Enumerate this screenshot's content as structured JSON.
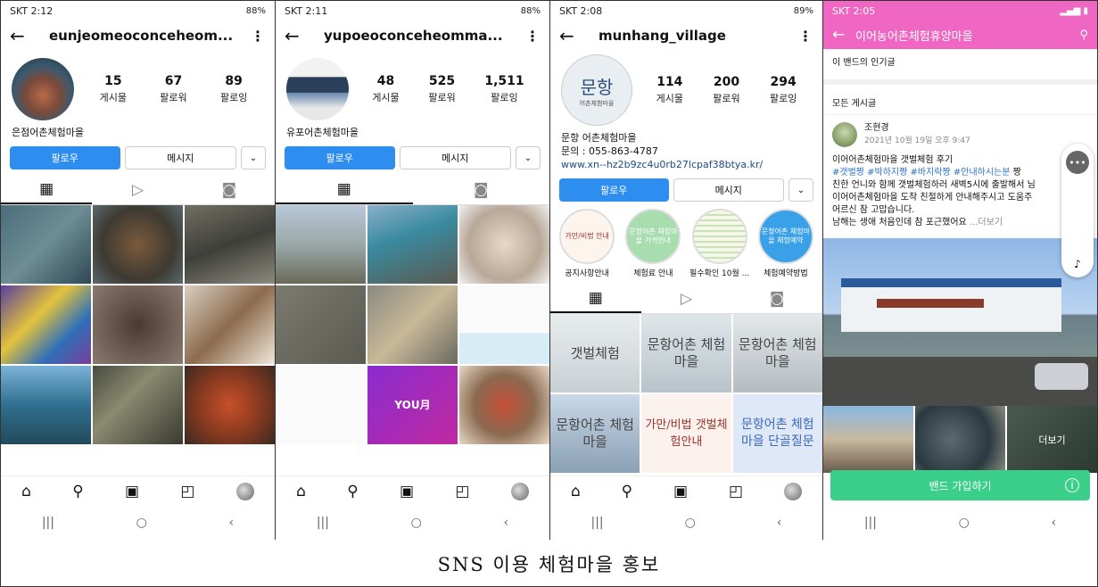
{
  "caption": "SNS 이용 체험마을 홍보",
  "phone1": {
    "status_time": "SKT 2:12",
    "status_right": "88%",
    "username": "eunjeomeoconceheom...",
    "stats": [
      {
        "value": "15",
        "label": "게시물"
      },
      {
        "value": "67",
        "label": "팔로워"
      },
      {
        "value": "89",
        "label": "팔로잉"
      }
    ],
    "name": "은점어촌체험마을",
    "follow_label": "팔로우",
    "message_label": "메시지"
  },
  "phone2": {
    "status_time": "SKT 2:11",
    "status_right": "88%",
    "username": "yupoeoconceheomma...",
    "stats": [
      {
        "value": "48",
        "label": "게시물"
      },
      {
        "value": "525",
        "label": "팔로워"
      },
      {
        "value": "1,511",
        "label": "팔로잉"
      }
    ],
    "name": "유포어촌체험마을",
    "follow_label": "팔로우",
    "message_label": "메시지",
    "tile_text": "YOU月"
  },
  "phone3": {
    "status_time": "SKT 2:08",
    "status_right": "89%",
    "username": "munhang_village",
    "avatar_text": "문항",
    "avatar_sub": "어촌체험마을",
    "stats": [
      {
        "value": "114",
        "label": "게시물"
      },
      {
        "value": "200",
        "label": "팔로워"
      },
      {
        "value": "294",
        "label": "팔로잉"
      }
    ],
    "name": "문항 어촌체험마을",
    "phone": "문의 : 055-863-4787",
    "link": "www.xn--hz2b9zc4u0rb27lcpaf38btya.kr/",
    "follow_label": "팔로우",
    "message_label": "메시지",
    "highlights": [
      {
        "circle": "가만/비법 안내",
        "label": "공지사항안내"
      },
      {
        "circle": "문항어촌 체험마을 가격안내",
        "label": "체험료 안내"
      },
      {
        "circle": "",
        "label": "필수확인 10월 ..."
      },
      {
        "circle": "문항어촌 체험마을 체험예약",
        "label": "체험예약방법"
      }
    ],
    "tiles": [
      "갯벌체험",
      "문항어촌 체험마을",
      "문항어촌 체험마을",
      "문항어촌 체험마을",
      "가만/비법 갯벌체험안내",
      "문항어촌 체험마을 단골질문"
    ]
  },
  "phone4": {
    "status_time": "SKT 2:05",
    "title": "이어농어촌체험휴양마을",
    "popular": "이 밴드의 인기글",
    "all_posts": "모든 게시글",
    "author": "조현경",
    "date": "2021년 10월 19일 오후 9:47",
    "line1": "이어어촌체험마을 갯벌체험 후기",
    "tags": "#갯벌짱 #박하지짱 #바지락짱 #안내하시는분",
    "tags_tail": " 짱",
    "line3": "친한 언니와 함께 갯벌체험하러 새벽5시에 출발해서 님",
    "line4": "이어어촌체험마을 도착 친절하게 안내해주시고 도움주",
    "line5": "어르신 참 고맙습니다.",
    "line6": "남해는 생애 처음인데 참 포근했어요",
    "more": " ...더보기",
    "thumb_more": "더보기",
    "join": "밴드 가입하기"
  }
}
